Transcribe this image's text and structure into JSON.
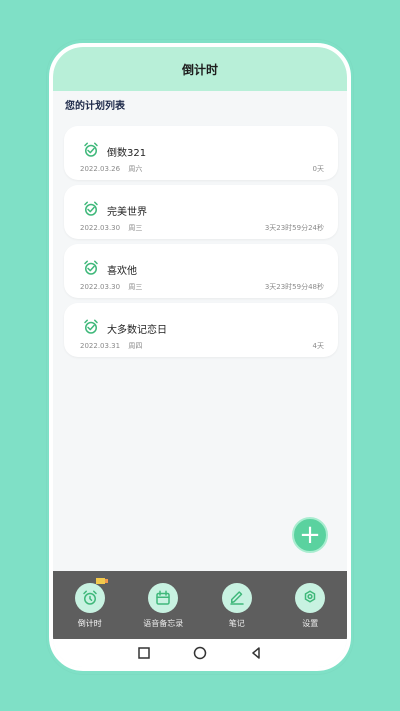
{
  "appbar": {
    "title": "倒计时"
  },
  "section": {
    "title": "您的计划列表"
  },
  "cards": [
    {
      "title": "倒数321",
      "date": "2022.03.26",
      "weekday": "周六",
      "remaining": "0天"
    },
    {
      "title": "完美世界",
      "date": "2022.03.30",
      "weekday": "周三",
      "remaining": "3天23时59分24秒"
    },
    {
      "title": "喜欢他",
      "date": "2022.03.30",
      "weekday": "周三",
      "remaining": "3天23时59分48秒"
    },
    {
      "title": "大多数记恋日",
      "date": "2022.03.31",
      "weekday": "周四",
      "remaining": "4天"
    }
  ],
  "fab": {
    "symbol": "+",
    "icon": "plus-icon"
  },
  "bottom_nav": [
    {
      "label": "倒计时",
      "icon": "alarm-clock-icon",
      "active": true
    },
    {
      "label": "语音备忘录",
      "icon": "calendar-icon",
      "active": false
    },
    {
      "label": "笔记",
      "icon": "pen-icon",
      "active": false
    },
    {
      "label": "设置",
      "icon": "settings-icon",
      "active": false
    }
  ],
  "android_nav": {
    "icons": [
      "square-icon",
      "circle-icon",
      "back-icon"
    ]
  },
  "colors": {
    "background": "#7fe0c6",
    "appbar": "#b8efd8",
    "accent": "#5ad29f",
    "nav": "#5e5e5e",
    "card": "#ffffff",
    "icon_green": "#3fb87a"
  }
}
